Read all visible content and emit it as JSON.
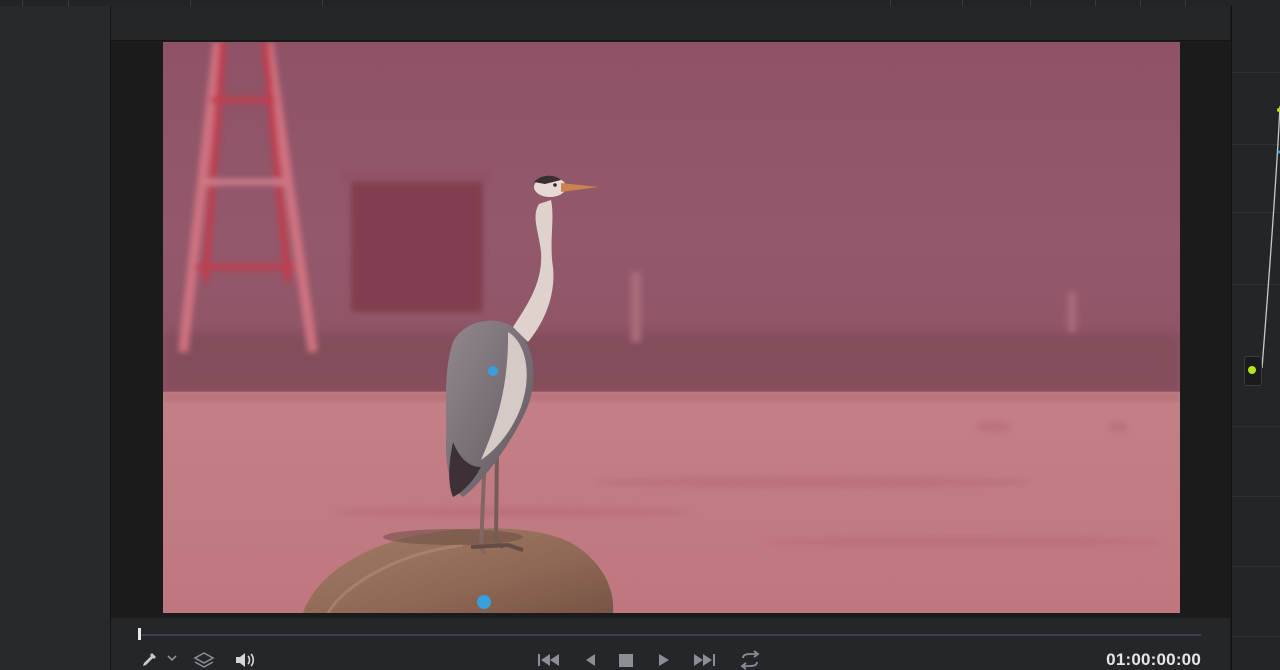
{
  "viewer": {
    "timecode": "01:00:00:00",
    "scrub_position": 0.0
  },
  "icons": {
    "picker": "eyedropper-icon",
    "picker_menu": "chevron-down-icon",
    "layers": "layers-icon",
    "audio": "speaker-icon",
    "go_start": "skip-back-icon",
    "step_back": "step-back-icon",
    "stop": "stop-icon",
    "play": "play-icon",
    "go_end": "skip-forward-icon",
    "loop": "loop-icon"
  },
  "colors": {
    "tracker_point": "#29a9e8",
    "node_output": "#b7e31a",
    "selection_overlay": "#c0506a"
  }
}
